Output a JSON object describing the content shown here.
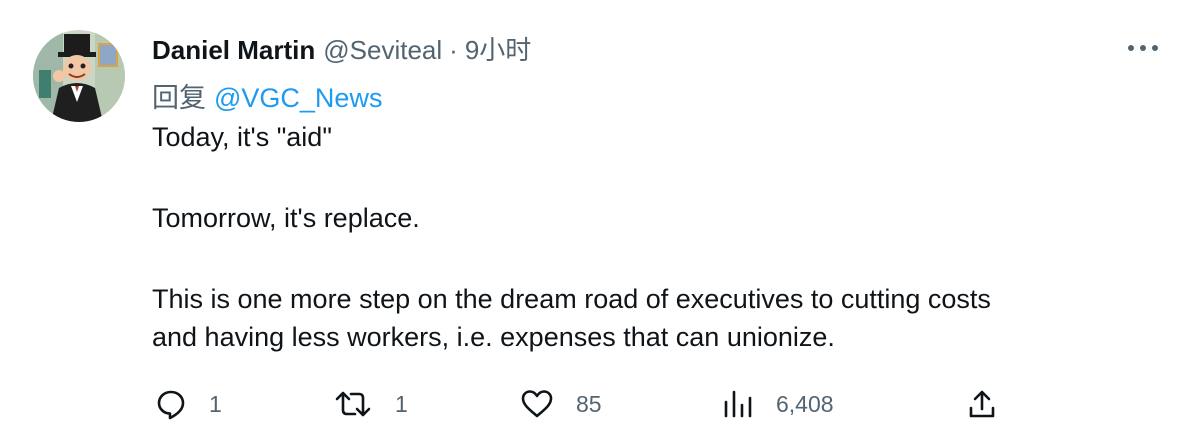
{
  "tweet": {
    "author_name": "Daniel Martin",
    "author_handle": "@Seviteal",
    "separator": "·",
    "time": "9小时",
    "reply_prefix": "回复",
    "reply_to": "@VGC_News",
    "lines": [
      "Today, it's \"aid\"",
      "Tomorrow, it's replace.",
      "This is one more step on the dream road of executives to cutting costs",
      "and having less workers, i.e. expenses that can unionize."
    ]
  },
  "actions": {
    "reply_count": "1",
    "retweet_count": "1",
    "like_count": "85",
    "views_count": "6,408"
  },
  "icons": {
    "more": "more-horizontal-icon",
    "reply": "comment-bubble-icon",
    "retweet": "retweet-arrows-icon",
    "like": "heart-icon",
    "views": "bar-chart-icon",
    "share": "share-upload-icon"
  },
  "colors": {
    "text": "#0f1419",
    "secondary": "#536471",
    "mention": "#1d9bf0"
  }
}
